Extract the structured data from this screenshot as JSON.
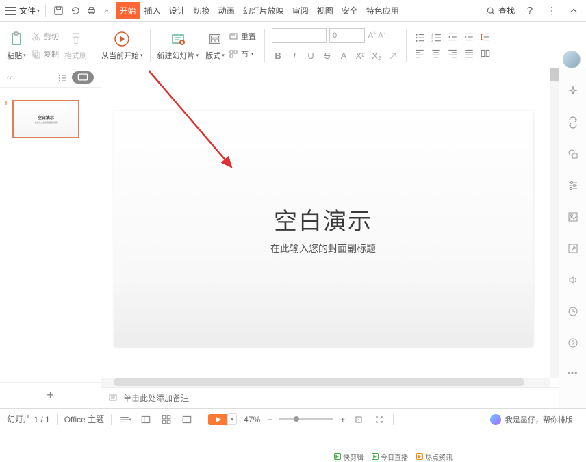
{
  "menubar": {
    "file": "文件",
    "tabs": [
      "开始",
      "插入",
      "设计",
      "切换",
      "动画",
      "幻灯片放映",
      "审阅",
      "视图",
      "安全",
      "特色应用"
    ],
    "active_tab_index": 0,
    "search": "查找"
  },
  "ribbon": {
    "cut": "剪切",
    "copy": "复制",
    "format_brush": "格式刷",
    "paste": "粘贴",
    "play_from_current": "从当前开始",
    "new_slide": "新建幻灯片",
    "layout": "版式",
    "reset": "重置",
    "section": "节",
    "font_size": "0"
  },
  "panel": {
    "thumbnails": [
      {
        "num": "1",
        "title": "空白演示",
        "subtitle": "在此输入您的封面副标题"
      }
    ]
  },
  "slide": {
    "title": "空白演示",
    "subtitle": "在此输入您的封面副标题"
  },
  "notes": {
    "placeholder": "单击此处添加备注"
  },
  "statusbar": {
    "slide_indicator": "幻灯片 1 / 1",
    "theme": "Office 主题",
    "zoom": "47%",
    "assistant": "我是墨仔，帮你排版...",
    "minus": "−",
    "plus": "+"
  },
  "bottom_partial": {
    "items": [
      "快剪辑",
      "今日直播",
      "热点资讯"
    ]
  }
}
